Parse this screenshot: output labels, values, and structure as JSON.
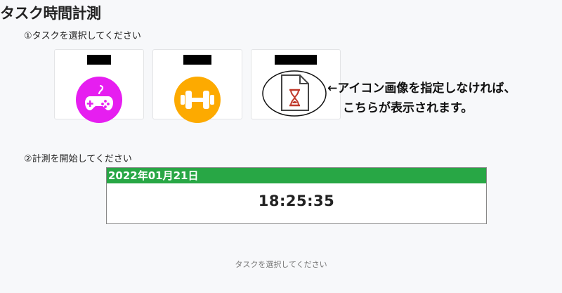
{
  "page": {
    "title": "タスク時間計測",
    "step1": "①タスクを選択してください",
    "step2": "②計測を開始してください",
    "footer_status": "タスクを選択してください"
  },
  "tasks": [
    {
      "icon": "gamepad-icon",
      "color": "#e61ef0"
    },
    {
      "icon": "dumbbell-icon",
      "color": "#fdaa00"
    },
    {
      "icon": "hourglass-document-icon",
      "color": "#c0392b"
    }
  ],
  "annotation": {
    "line1": "←アイコン画像を指定しなければ、",
    "line2": "こちらが表示されます。"
  },
  "clock": {
    "date": "2022年01月21日",
    "time": "18:25:35",
    "header_color": "#28a745"
  }
}
